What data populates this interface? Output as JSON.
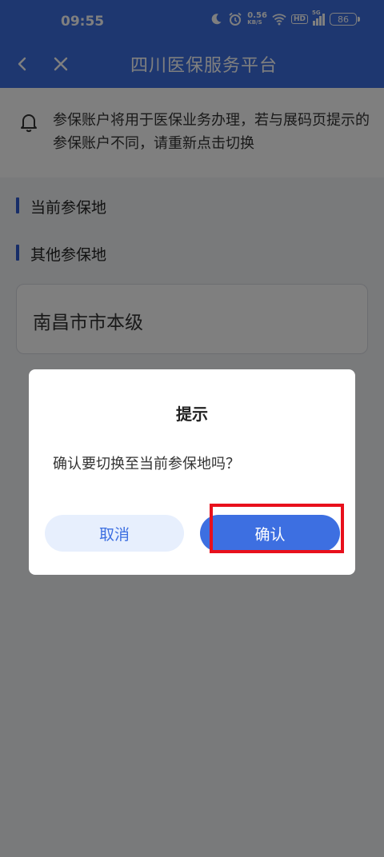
{
  "status_bar": {
    "time": "09:55",
    "speed_value": "0.56",
    "speed_unit": "KB/S",
    "hd_label": "HD",
    "network_label": "5G",
    "battery": "86"
  },
  "navbar": {
    "title": "四川医保服务平台"
  },
  "notice": {
    "text": "参保账户将用于医保业务办理，若与展码页提示的参保账户不同，请重新点击切换"
  },
  "sections": {
    "current_title": "当前参保地",
    "other_title": "其他参保地"
  },
  "location": {
    "name": "南昌市市本级"
  },
  "dialog": {
    "title": "提示",
    "message": "确认要切换至当前参保地吗？",
    "cancel_label": "取消",
    "confirm_label": "确认"
  },
  "colors": {
    "brand_blue": "#3d6fe1",
    "highlight_red": "#e8101c"
  }
}
